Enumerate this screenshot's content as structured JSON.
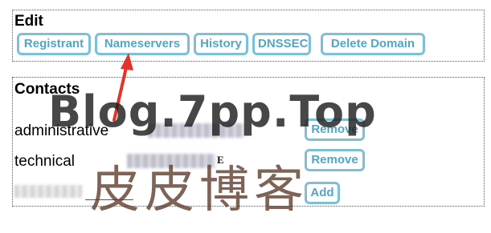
{
  "edit": {
    "title": "Edit",
    "buttons": [
      "Registrant",
      "Nameservers",
      "History",
      "DNSSEC",
      "Delete Domain"
    ]
  },
  "contacts": {
    "title": "Contacts",
    "rows": [
      {
        "label": "administrative",
        "button": "Remove"
      },
      {
        "label": "technical",
        "value_tail": "E",
        "button": "Remove"
      }
    ],
    "add_button": "Add"
  },
  "watermark": {
    "line1": "Blog.7pp.Top",
    "line2": "皮皮博客"
  },
  "colors": {
    "button_border": "#7cc0d8",
    "button_text": "#52a6c4",
    "arrow": "#e5332a"
  }
}
